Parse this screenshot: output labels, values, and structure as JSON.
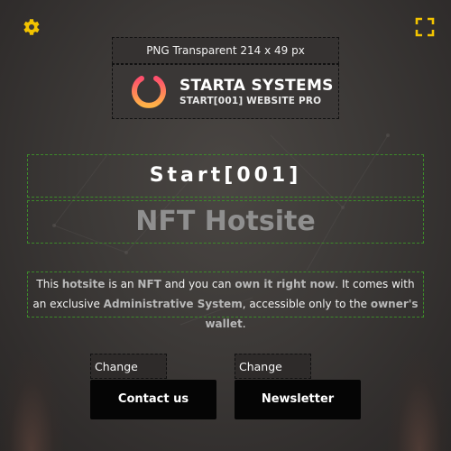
{
  "toolbar": {
    "settings_icon": "gear-icon",
    "fullscreen_icon": "fullscreen-icon",
    "accent_color": "#f2c300"
  },
  "logo": {
    "caption": "PNG Transparent 214 x 49 px",
    "brand_name": "STARTA SYSTEMS",
    "brand_sub": "START[001] WEBSITE PRO",
    "icon": "power-icon"
  },
  "hero": {
    "title": "Start[001]",
    "headline": "NFT Hotsite"
  },
  "description": {
    "p1": "This ",
    "h1": "hotsite",
    "p2": " is an ",
    "h2": "NFT",
    "p3": " and you can ",
    "h3": "own it right now",
    "p4": ". It comes with an exclusive ",
    "h4": "Administrative System",
    "p5": ", accessible only to the ",
    "h5": "owner's wallet",
    "p6": "."
  },
  "buttons": {
    "left_change_label": "Change text",
    "right_change_label": "Change text",
    "contact_label": "Contact us",
    "newsletter_label": "Newsletter"
  }
}
